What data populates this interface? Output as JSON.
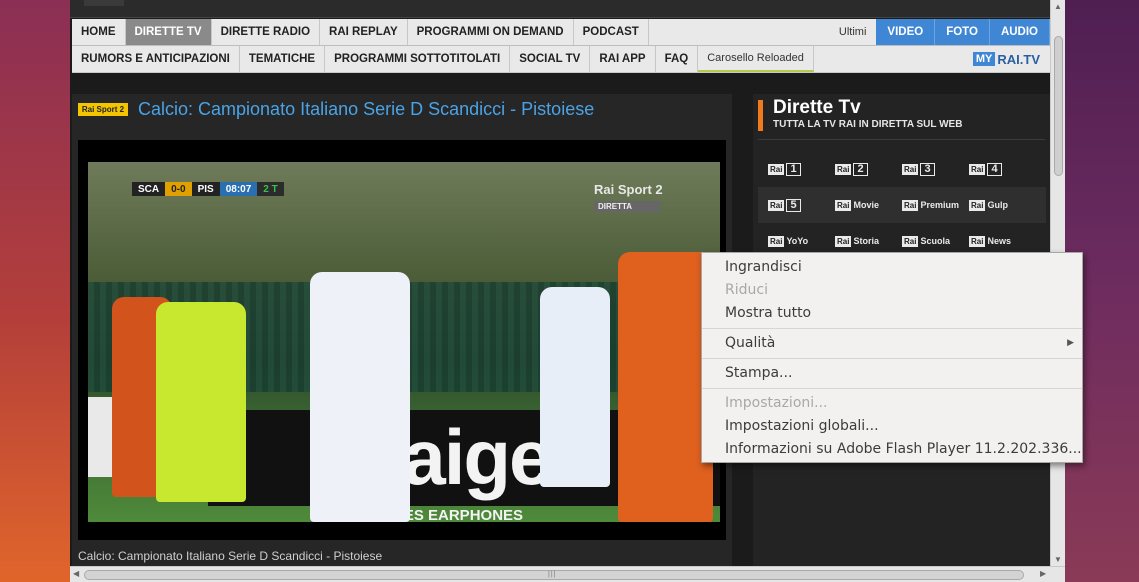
{
  "nav": {
    "primary": [
      "HOME",
      "DIRETTE TV",
      "DIRETTE RADIO",
      "RAI REPLAY",
      "PROGRAMMI ON DEMAND",
      "PODCAST"
    ],
    "ultimi": "Ultimi",
    "media": [
      "VIDEO",
      "FOTO",
      "AUDIO"
    ],
    "secondary": [
      "RUMORS E ANTICIPAZIONI",
      "TEMATICHE",
      "PROGRAMMI SOTTOTITOLATI",
      "SOCIAL TV",
      "RAI APP",
      "FAQ"
    ],
    "carosello": "Carosello Reloaded",
    "myrai_my": "MY",
    "myrai_label": "RAI.TV"
  },
  "video": {
    "logo_text": "Rai Sport 2",
    "title": "Calcio: Campionato Italiano Serie D Scandicci - Pistoiese",
    "caption": "Calcio: Campionato Italiano Serie D Scandicci - Pistoiese",
    "scoreboard": {
      "home": "SCA",
      "score": "0-0",
      "away": "PIS",
      "time": "08:07",
      "half": "2 T"
    },
    "channel_bug": "Rai Sport 2",
    "live_label": "DIRETTA",
    "banner_text": "Haige",
    "banner_sub": "HEADPHONES EARPHONES"
  },
  "sidebar": {
    "title": "Dirette Tv",
    "subtitle": "TUTTA LA TV RAI IN DIRETTA SUL WEB",
    "rai_prefix": "Rai",
    "rows": [
      [
        "1",
        "2",
        "3",
        "4"
      ],
      [
        "5",
        "Movie",
        "Premium",
        "Gulp"
      ],
      [
        "YoYo",
        "Storia",
        "Scuola",
        "News"
      ]
    ]
  },
  "context_menu": {
    "items": [
      {
        "label": "Ingrandisci",
        "enabled": true
      },
      {
        "label": "Riduci",
        "enabled": false
      },
      {
        "label": "Mostra tutto",
        "enabled": true
      },
      {
        "label": "Qualità",
        "enabled": true,
        "submenu": true
      },
      {
        "label": "Stampa...",
        "enabled": true
      },
      {
        "label": "Impostazioni...",
        "enabled": false
      },
      {
        "label": "Impostazioni globali...",
        "enabled": true
      },
      {
        "label": "Informazioni su Adobe Flash Player 11.2.202.336...",
        "enabled": true
      }
    ]
  },
  "colors": {
    "accent_blue": "#3f86d4",
    "title_blue": "#4aa3e6",
    "accent_orange": "#f07a1e"
  }
}
